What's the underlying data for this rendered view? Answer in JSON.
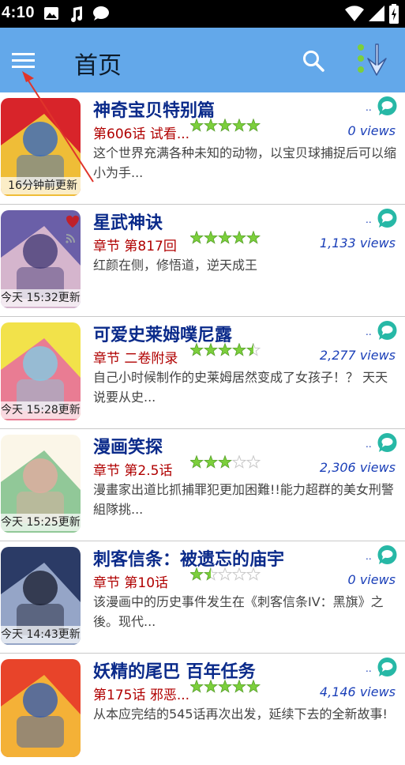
{
  "status_bar": {
    "time": "4:10"
  },
  "app_bar": {
    "title": "首页"
  },
  "comics": [
    {
      "title": "神奇宝贝特别篇",
      "chapter": "第606话 试看...",
      "rating": 5,
      "views": "0 views",
      "description": "这个世界充满各种未知的动物，以宝贝球捕捉后可以缩小为手...",
      "update": "16分钟前更新",
      "colors": [
        "#d8242a",
        "#f3d83a",
        "#2a64c8"
      ]
    },
    {
      "title": "星武神诀",
      "chapter": "章节 第817回",
      "rating": 5,
      "views": "1,133 views",
      "description": "红颜在侧，修悟道，逆天成王",
      "update": "今天 15:32更新",
      "colors": [
        "#6a5fa8",
        "#e8c4d4",
        "#3b3470"
      ]
    },
    {
      "title": "可爱史莱姆噗尼露",
      "chapter": "章节 二卷附录",
      "rating": 4.5,
      "views": "2,277 views",
      "description": "自己小时候制作的史莱姆居然变成了女孩子！？ 天天说要从史...",
      "update": "今天 15:28更新",
      "colors": [
        "#f2e24a",
        "#e86aa0",
        "#7bd0e8"
      ]
    },
    {
      "title": "漫画笑探",
      "chapter": "章节 第2.5话",
      "rating": 3,
      "views": "2,306 views",
      "description": "漫畫家出道比抓捕罪犯更加困難!!能力超群的美女刑警組隊挑...",
      "update": "今天 15:25更新",
      "colors": [
        "#fbf6e8",
        "#7ec08a",
        "#e8a9a0"
      ]
    },
    {
      "title": "刺客信条：被遗忘的庙宇",
      "chapter": "章节 第10话",
      "rating": 1.5,
      "views": "0 views",
      "description": "该漫画中的历史事件发生在《刺客信条IV：黑旗》之後。现代...",
      "update": "今天 14:43更新",
      "colors": [
        "#2b3b66",
        "#a8b8d8",
        "#14182a"
      ]
    },
    {
      "title": "妖精的尾巴 百年任务",
      "chapter": "第175话 邪恶...",
      "rating": 5,
      "views": "4,146 views",
      "description": "从本应完结的545话再次出发，延续下去的全新故事!",
      "update": "",
      "colors": [
        "#e8442a",
        "#f6c43a",
        "#2a58b8"
      ]
    }
  ],
  "icons": {
    "menu": "hamburger-menu-icon",
    "search": "search-icon",
    "download": "download-icon",
    "comment": "comment-icon",
    "star": "star-icon"
  },
  "theme": {
    "app_bar": "#63a8ea",
    "title": "#0a2a8a",
    "chapter": "#b00000",
    "views": "#1a3fb8",
    "star": "#7ccf3c",
    "comment": "#27b8a6"
  }
}
